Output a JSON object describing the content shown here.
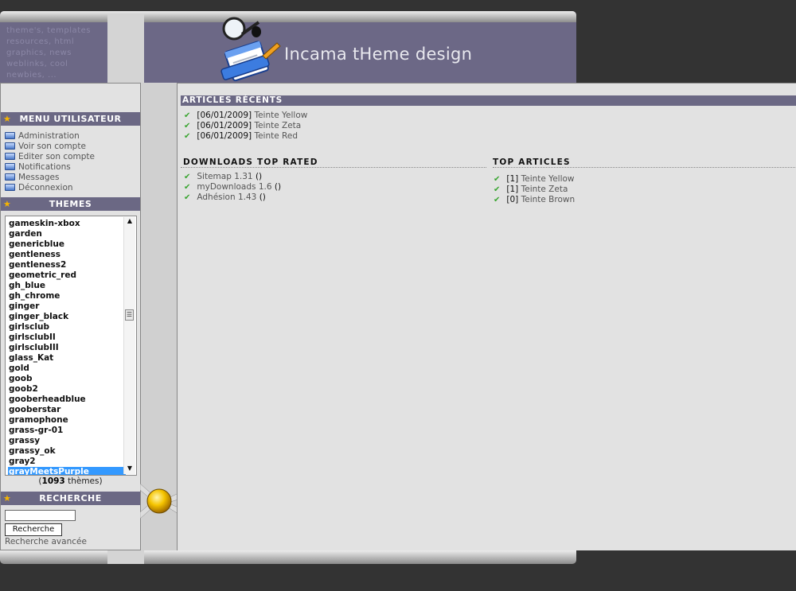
{
  "header": {
    "tagline": [
      "theme's, templates",
      "resources, html",
      "graphics, news",
      "weblinks, cool",
      "newbies, ..."
    ],
    "brand": "Incama tHeme design"
  },
  "sidebar": {
    "menu_title": "MENU UTILISATEUR",
    "menu_items": [
      "Administration",
      "Voir son compte",
      "Editer son compte",
      "Notifications",
      "Messages",
      "Déconnexion"
    ],
    "themes_title": "THEMES",
    "themes": [
      "gameskin-xbox",
      "garden",
      "genericblue",
      "gentleness",
      "gentleness2",
      "geometric_red",
      "gh_blue",
      "gh_chrome",
      "ginger",
      "ginger_black",
      "girlsclub",
      "girlsclubII",
      "girlsclubIII",
      "glass_Kat",
      "gold",
      "goob",
      "goob2",
      "gooberheadblue",
      "gooberstar",
      "gramophone",
      "grass-gr-01",
      "grassy",
      "grassy_ok",
      "gray2",
      "grayMeetsPurple"
    ],
    "selected_theme": "grayMeetsPurple",
    "theme_count": "1093",
    "theme_count_suffix": " thèmes)",
    "theme_count_prefix": "(",
    "search_title": "RECHERCHE",
    "search_value": "",
    "search_button": "Recherche",
    "advanced_search": "Recherche avancée"
  },
  "main": {
    "recent_title": "ARTICLES RÉCENTS",
    "recent": [
      {
        "date": "[06/01/2009]",
        "title": "Teinte Yellow"
      },
      {
        "date": "[06/01/2009]",
        "title": "Teinte Zeta"
      },
      {
        "date": "[06/01/2009]",
        "title": "Teinte Red"
      }
    ],
    "downloads_title": "DOWNLOADS TOP RATED",
    "downloads": [
      {
        "name": "Sitemap 1.31",
        "rating": "()"
      },
      {
        "name": "myDownloads 1.6",
        "rating": "()"
      },
      {
        "name": "Adhésion 1.43",
        "rating": "()"
      }
    ],
    "top_title": "TOP ARTICLES",
    "top": [
      {
        "count": "[1]",
        "title": "Teinte Yellow"
      },
      {
        "count": "[1]",
        "title": "Teinte Zeta"
      },
      {
        "count": "[0]",
        "title": "Teinte Brown"
      }
    ]
  },
  "colors": {
    "header_purple": "#6c6886",
    "bar_purple": "#6b6884",
    "panel_gray": "#e2e2e2",
    "background": "#333333",
    "check_green": "#3aa531",
    "star_orange": "#f5b400",
    "selection_blue": "#3399ff"
  },
  "icons": {
    "menu_item": "folder-icon",
    "section": "star-icon",
    "list_bullet": "checkmark-icon",
    "logo": "magnifier-document-icon",
    "decor": "yellow-ball-icon"
  }
}
